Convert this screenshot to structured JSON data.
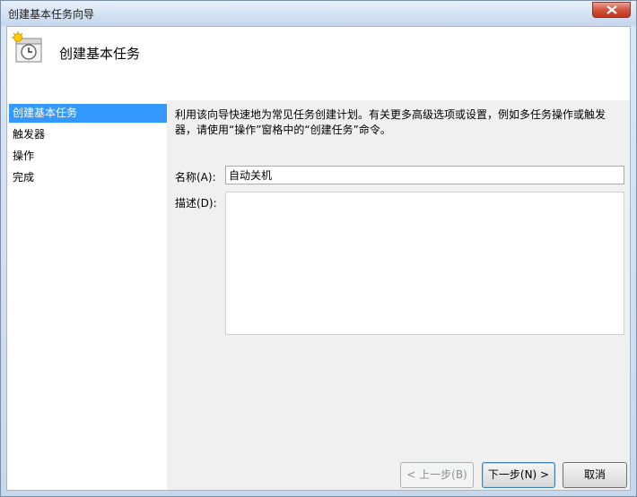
{
  "window": {
    "title": "创建基本任务向导"
  },
  "header": {
    "title": "创建基本任务",
    "icon": "calendar-clock-icon"
  },
  "nav": {
    "items": [
      {
        "label": "创建基本任务",
        "selected": true
      },
      {
        "label": "触发器",
        "selected": false
      },
      {
        "label": "操作",
        "selected": false
      },
      {
        "label": "完成",
        "selected": false
      }
    ]
  },
  "main": {
    "description_line1": "利用该向导快速地为常见任务创建计划。有关更多高级选项或设置，例如多任务操作或触发",
    "description_line2": "器，请使用“操作”窗格中的“创建任务”命令。",
    "name_label": "名称(A):",
    "name_value": "自动关机",
    "desc_label": "描述(D):",
    "desc_value": ""
  },
  "buttons": {
    "back": "< 上一步(B)",
    "next": "下一步(N) >",
    "cancel": "取消"
  },
  "colors": {
    "selection": "#3399ff",
    "close_button": "#c1341a"
  }
}
